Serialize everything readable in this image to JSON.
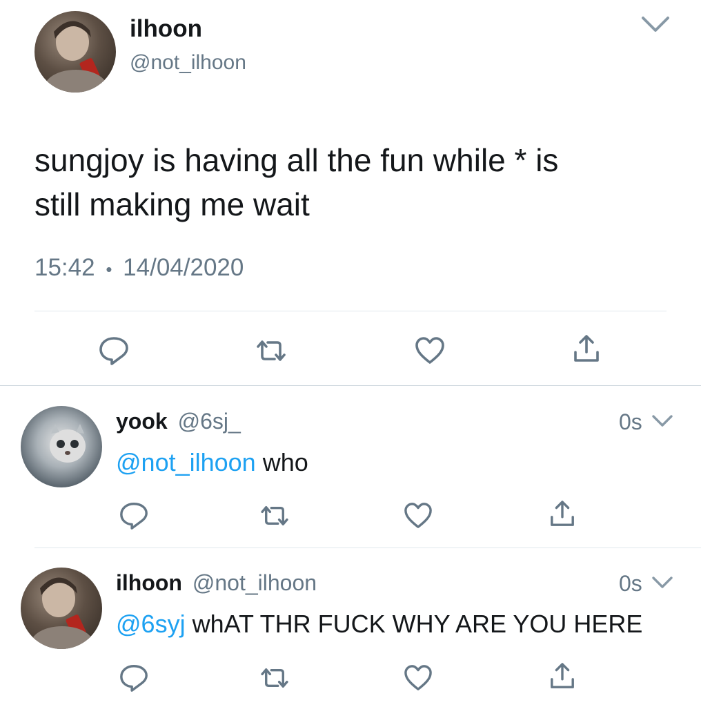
{
  "main_tweet": {
    "display_name": "ilhoon",
    "handle": "@not_ilhoon",
    "text_line1": "sungjoy is having all the fun while * is",
    "text_line2": "still making me wait",
    "time": "15:42",
    "separator": "•",
    "date": "14/04/2020"
  },
  "replies": [
    {
      "display_name": "yook",
      "handle": "@6sj_",
      "age": "0s",
      "mention": "@not_ilhoon",
      "text": " who"
    },
    {
      "display_name": "ilhoon",
      "handle": "@not_ilhoon",
      "age": "0s",
      "mention": "@6syj",
      "text": " whAT THR FUCK WHY ARE YOU HERE"
    }
  ],
  "icons": {
    "reply": "reply-icon",
    "retweet": "retweet-icon",
    "like": "heart-icon",
    "share": "share-icon",
    "menu": "chevron-down-icon"
  },
  "colors": {
    "mention": "#1da1f2",
    "muted": "#657786",
    "text": "#14171a",
    "divider": "#e1e8ed"
  }
}
